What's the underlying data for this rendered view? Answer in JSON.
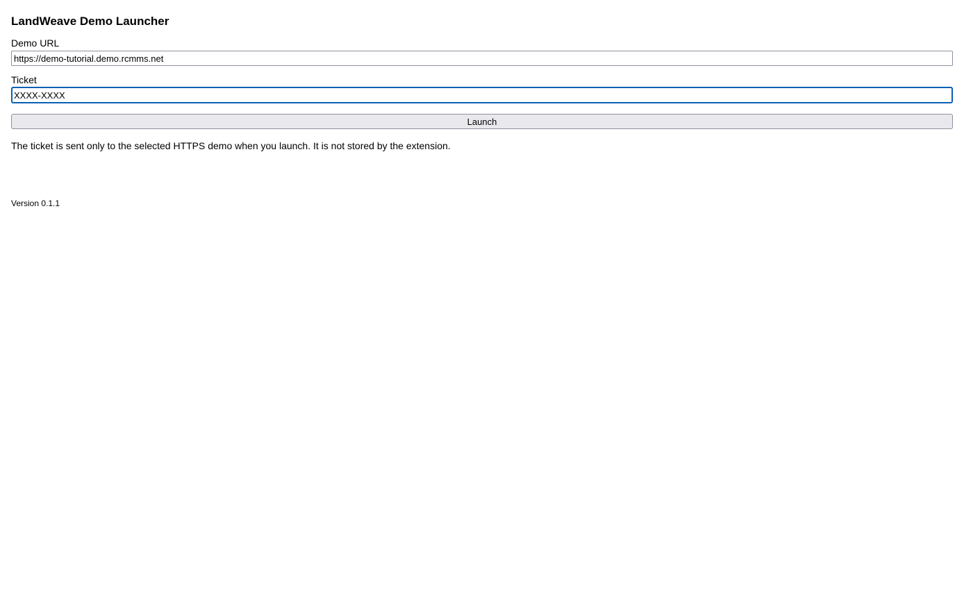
{
  "app": {
    "title": "LandWeave Demo Launcher"
  },
  "form": {
    "url_label": "Demo URL",
    "url_value": "https://demo-tutorial.demo.rcmms.net",
    "ticket_label": "Ticket",
    "ticket_value": "XXXX-XXXX",
    "launch_label": "Launch"
  },
  "note": "The ticket is sent only to the selected HTTPS demo when you launch. It is not stored by the extension.",
  "footer": {
    "version": "Version 0.1.1"
  },
  "colors": {
    "focus_border": "#0a5fb4",
    "button_bg": "#e9e9ed",
    "input_border": "#8f8f9d"
  }
}
